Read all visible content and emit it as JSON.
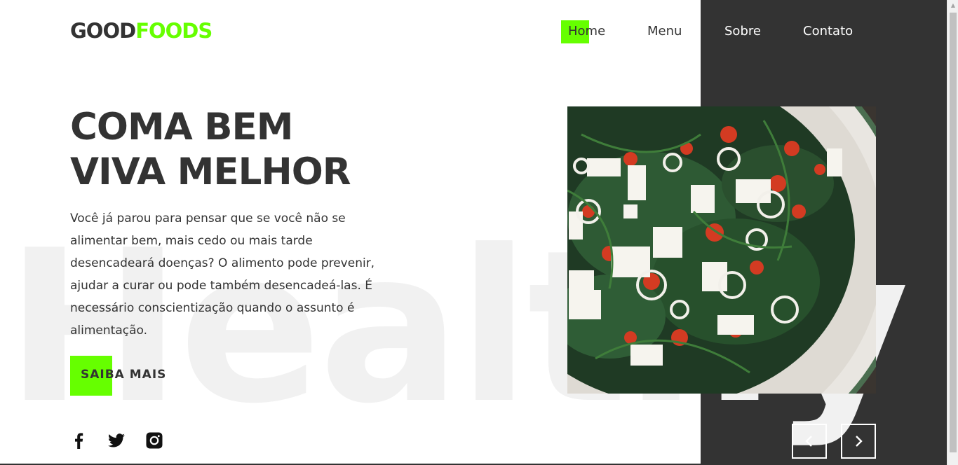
{
  "brand": {
    "logo_part1": "GOOD",
    "logo_part2": "FOODS"
  },
  "nav": {
    "items": [
      "Home",
      "Menu",
      "Sobre",
      "Contato"
    ],
    "active": "Home"
  },
  "hero": {
    "headline_line1": "COMA BEM",
    "headline_line2": "VIVA MELHOR",
    "description": "Você já parou para pensar que se você não se alimentar bem, mais cedo ou mais tarde desencadeará doenças? O alimento pode prevenir, ajudar a curar ou pode também desencadeá-las. É necessário conscientização quando o assunto é alimentação.",
    "cta_label": "SAIBA MAIS",
    "background_word": "Healthy"
  },
  "social": [
    "facebook-icon",
    "twitter-icon",
    "instagram-icon"
  ],
  "slider": {
    "prev": "chevron-left-icon",
    "next": "chevron-right-icon"
  },
  "colors": {
    "accent": "#66ff00",
    "dark": "#333333",
    "text": "#333333",
    "background": "#ffffff"
  }
}
